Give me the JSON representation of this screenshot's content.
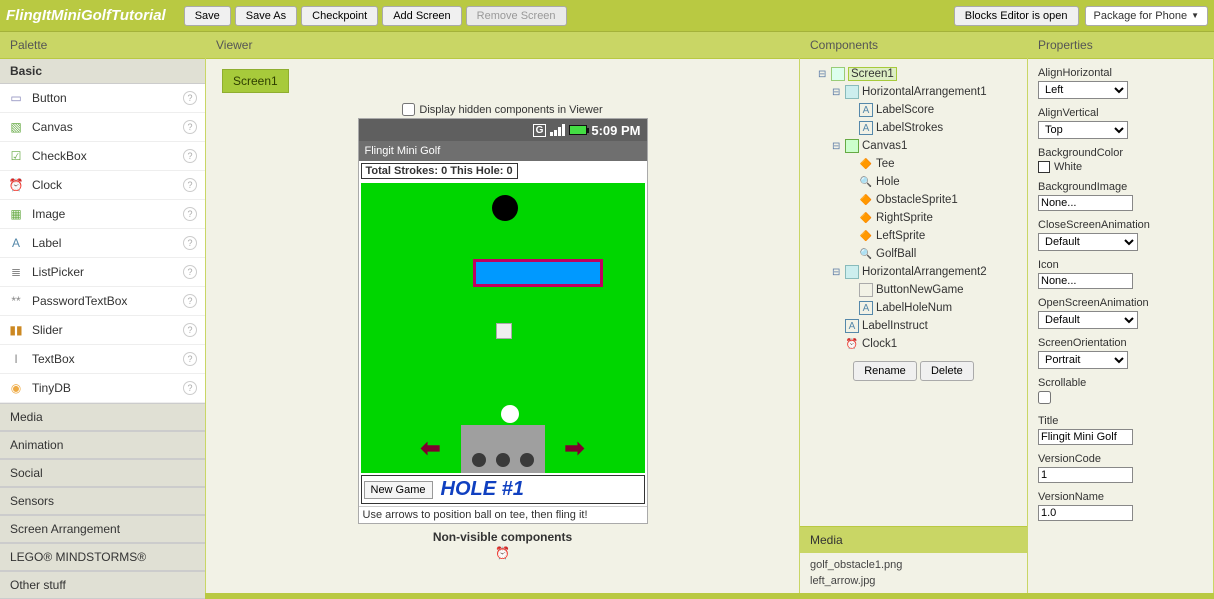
{
  "header": {
    "title": "FlingItMiniGolfTutorial",
    "buttons": {
      "save": "Save",
      "saveAs": "Save As",
      "checkpoint": "Checkpoint",
      "addScreen": "Add Screen",
      "removeScreen": "Remove Screen"
    },
    "blocks": "Blocks Editor is open",
    "packageBtn": "Package for Phone"
  },
  "palette": {
    "title": "Palette",
    "basic": "Basic",
    "items": [
      {
        "icon": "▭",
        "label": "Button",
        "c": "#88b"
      },
      {
        "icon": "▧",
        "label": "Canvas",
        "c": "#6a4"
      },
      {
        "icon": "☑",
        "label": "CheckBox",
        "c": "#6a4"
      },
      {
        "icon": "⏰",
        "label": "Clock",
        "c": "#d98"
      },
      {
        "icon": "▦",
        "label": "Image",
        "c": "#6a4"
      },
      {
        "icon": "A",
        "label": "Label",
        "c": "#58a"
      },
      {
        "icon": "≣",
        "label": "ListPicker",
        "c": "#888"
      },
      {
        "icon": "**",
        "label": "PasswordTextBox",
        "c": "#888"
      },
      {
        "icon": "▮▮",
        "label": "Slider",
        "c": "#c82"
      },
      {
        "icon": "I",
        "label": "TextBox",
        "c": "#888"
      },
      {
        "icon": "◉",
        "label": "TinyDB",
        "c": "#ea4"
      }
    ],
    "cats": [
      "Media",
      "Animation",
      "Social",
      "Sensors",
      "Screen Arrangement",
      "LEGO® MINDSTORMS®",
      "Other stuff"
    ]
  },
  "viewer": {
    "title": "Viewer",
    "screenTab": "Screen1",
    "hiddenLabel": "Display hidden components in Viewer",
    "time": "5:09 PM",
    "appbar": "Flingit Mini Golf",
    "scoreLabel": "Total Strokes: 0   This Hole: 0",
    "newGame": "New Game",
    "holeNum": "HOLE #1",
    "instruct": "Use arrows to position ball on tee, then fling it!",
    "nonVisible": "Non-visible components"
  },
  "components": {
    "title": "Components",
    "tree": {
      "root": "Screen1",
      "ha1": "HorizontalArrangement1",
      "labelScore": "LabelScore",
      "labelStrokes": "LabelStrokes",
      "canvas": "Canvas1",
      "tee": "Tee",
      "hole": "Hole",
      "obs": "ObstacleSprite1",
      "right": "RightSprite",
      "left": "LeftSprite",
      "golfball": "GolfBall",
      "ha2": "HorizontalArrangement2",
      "btnNew": "ButtonNewGame",
      "labelHole": "LabelHoleNum",
      "labelInstr": "LabelInstruct",
      "clock": "Clock1"
    },
    "rename": "Rename",
    "delete": "Delete",
    "mediaTitle": "Media",
    "media": [
      "golf_obstacle1.png",
      "left_arrow.jpg"
    ]
  },
  "properties": {
    "title": "Properties",
    "alignH": {
      "label": "AlignHorizontal",
      "value": "Left"
    },
    "alignV": {
      "label": "AlignVertical",
      "value": "Top"
    },
    "bgColor": {
      "label": "BackgroundColor",
      "value": "White"
    },
    "bgImage": {
      "label": "BackgroundImage",
      "value": "None..."
    },
    "closeAnim": {
      "label": "CloseScreenAnimation",
      "value": "Default"
    },
    "icon": {
      "label": "Icon",
      "value": "None..."
    },
    "openAnim": {
      "label": "OpenScreenAnimation",
      "value": "Default"
    },
    "orient": {
      "label": "ScreenOrientation",
      "value": "Portrait"
    },
    "scroll": {
      "label": "Scrollable"
    },
    "ptitle": {
      "label": "Title",
      "value": "Flingit Mini Golf"
    },
    "vcode": {
      "label": "VersionCode",
      "value": "1"
    },
    "vname": {
      "label": "VersionName",
      "value": "1.0"
    }
  }
}
